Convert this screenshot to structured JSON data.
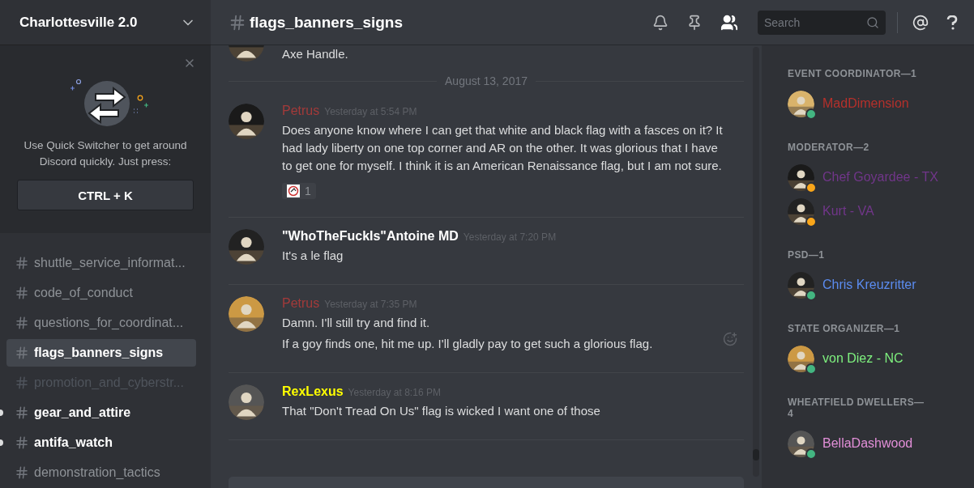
{
  "server": {
    "name": "Charlottesville 2.0"
  },
  "quick_switcher": {
    "text": "Use Quick Switcher to get around Discord quickly. Just press:",
    "shortcut": "CTRL + K"
  },
  "channels": [
    {
      "name": "shuttle_service_informat...",
      "selected": false,
      "unread": false,
      "muted": false
    },
    {
      "name": "code_of_conduct",
      "selected": false,
      "unread": false,
      "muted": false
    },
    {
      "name": "questions_for_coordinat...",
      "selected": false,
      "unread": false,
      "muted": false
    },
    {
      "name": "flags_banners_signs",
      "selected": true,
      "unread": false,
      "muted": false
    },
    {
      "name": "promotion_and_cyberstr...",
      "selected": false,
      "unread": false,
      "muted": true
    },
    {
      "name": "gear_and_attire",
      "selected": false,
      "unread": true,
      "muted": false
    },
    {
      "name": "antifa_watch",
      "selected": false,
      "unread": true,
      "muted": false
    },
    {
      "name": "demonstration_tactics",
      "selected": false,
      "unread": false,
      "muted": false
    }
  ],
  "channel_header": {
    "title": "flags_banners_signs",
    "search": {
      "placeholder": "Search"
    }
  },
  "messages": [
    {
      "kind": "partial",
      "lines": [
        "Axe Handle."
      ]
    },
    {
      "kind": "divider",
      "date": "August 13, 2017"
    },
    {
      "kind": "message",
      "author": "Petrus",
      "color": "#a33a3a",
      "time": "Yesterday at 5:54 PM",
      "lines": [
        "Does anyone know where I can get that white and black flag with a fasces on it? It had lady liberty on one top corner and AR on the other. It was glorious that I have to get one for myself. I think it is an American Renaissance flag, but I am not sure."
      ],
      "reaction_count": "1",
      "add_reaction": false
    },
    {
      "kind": "message",
      "author": "\"WhoTheFuckIs\"Antoine MD",
      "color": "#ffffff",
      "time": "Yesterday at 7:20 PM",
      "lines": [
        "It's a le flag"
      ],
      "add_reaction": false
    },
    {
      "kind": "message",
      "author": "Petrus",
      "color": "#a33a3a",
      "time": "Yesterday at 7:35 PM",
      "lines": [
        "Damn. I'll still try and find it.",
        "If a goy finds one, hit me up. I'll gladly pay to get such a glorious flag."
      ],
      "add_reaction": true
    },
    {
      "kind": "message",
      "author": "RexLexus",
      "color": "#ffff00",
      "time": "Yesterday at 8:16 PM",
      "lines": [
        "That \"Don't Tread On Us\" flag is wicked I want one of those"
      ],
      "add_reaction": false
    }
  ],
  "member_groups": [
    {
      "title": "EVENT COORDINATOR—1",
      "members": [
        {
          "name": "MadDimension",
          "color": "#b5302b",
          "idle": false
        }
      ]
    },
    {
      "title": "MODERATOR—2",
      "members": [
        {
          "name": "Chef Goyardee - TX",
          "color": "#71368a",
          "idle": true
        },
        {
          "name": "Kurt - VA",
          "color": "#71368a",
          "idle": true
        }
      ]
    },
    {
      "title": "PSD—1",
      "members": [
        {
          "name": "Chris Kreuzritter",
          "color": "#5b8cf0",
          "idle": false
        }
      ]
    },
    {
      "title": "STATE ORGANIZER—1",
      "members": [
        {
          "name": "von Diez - NC",
          "color": "#7ef07e",
          "idle": false
        }
      ]
    },
    {
      "title": "WHEATFIELD DWELLERS—4",
      "members": [
        {
          "name": "BellaDashwood",
          "color": "#e28fd8",
          "idle": false
        }
      ]
    }
  ]
}
